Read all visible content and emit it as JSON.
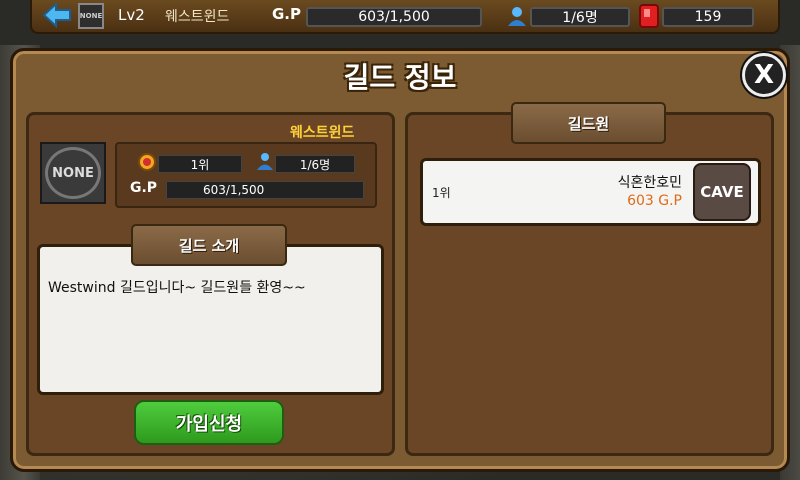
{
  "topbar": {
    "emblem": "NONE",
    "level": "Lv2",
    "guild_name": "웨스트윈드",
    "gp_label": "G.P",
    "gp_value": "603/1,500",
    "members": "1/6명",
    "gems": "159"
  },
  "dialog": {
    "title": "길드 정보",
    "close_label": "X"
  },
  "guild": {
    "name": "웨스트윈드",
    "emblem": "NONE",
    "rank": "1위",
    "members": "1/6명",
    "gp_label": "G.P",
    "gp_value": "603/1,500"
  },
  "intro": {
    "title": "길드 소개",
    "text": "Westwind 길드입니다~ 길드원들 환영~~"
  },
  "join_button": "가입신청",
  "members_panel": {
    "title": "길드원",
    "rows": [
      {
        "rank": "1위",
        "name": "식혼한호민",
        "gp": "603 G.P",
        "button": "CAVE"
      }
    ]
  },
  "colors": {
    "accent_gold": "#ffd23a",
    "gp_orange": "#e06a1a",
    "join_green": "#3fb82e"
  }
}
